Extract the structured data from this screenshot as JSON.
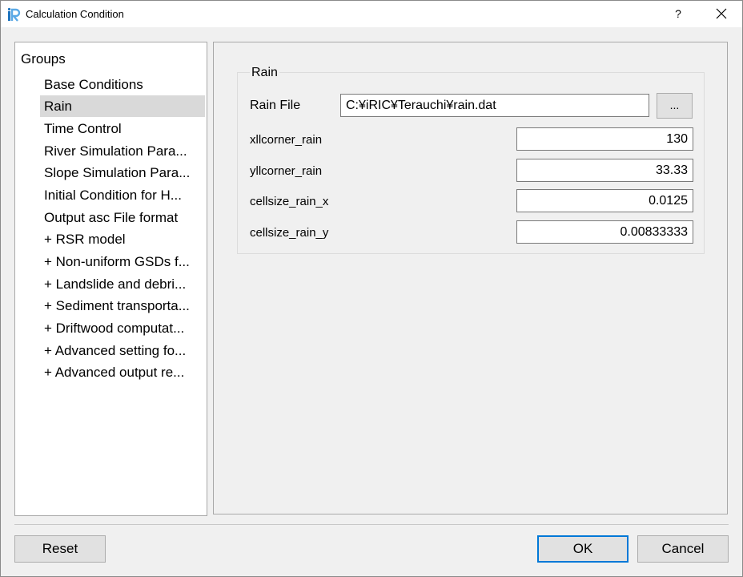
{
  "window": {
    "title": "Calculation Condition",
    "help_label": "?"
  },
  "groups": {
    "header": "Groups",
    "items": [
      {
        "label": "Base Conditions"
      },
      {
        "label": "Rain"
      },
      {
        "label": "Time Control"
      },
      {
        "label": "River Simulation Para..."
      },
      {
        "label": "Slope Simulation Para..."
      },
      {
        "label": "Initial Condition for H..."
      },
      {
        "label": "Output asc File format"
      },
      {
        "label": "+ RSR model"
      },
      {
        "label": "+ Non-uniform GSDs f..."
      },
      {
        "label": "+ Landslide and debri..."
      },
      {
        "label": "+ Sediment transporta..."
      },
      {
        "label": "+ Driftwood computat..."
      },
      {
        "label": "+ Advanced setting fo..."
      },
      {
        "label": "+ Advanced output re..."
      }
    ],
    "selected": "Rain"
  },
  "rain": {
    "group_title": "Rain",
    "file_label": "Rain File",
    "file_value": "C:¥iRIC¥Terauchi¥rain.dat",
    "browse_label": "...",
    "fields": [
      {
        "label": "xllcorner_rain",
        "value": "130"
      },
      {
        "label": "yllcorner_rain",
        "value": "33.33"
      },
      {
        "label": "cellsize_rain_x",
        "value": "0.0125"
      },
      {
        "label": "cellsize_rain_y",
        "value": "0.00833333"
      }
    ]
  },
  "buttons": {
    "reset": "Reset",
    "ok": "OK",
    "cancel": "Cancel"
  },
  "colors": {
    "selection": "#d9d9d9",
    "default_button_border": "#0078d7"
  }
}
